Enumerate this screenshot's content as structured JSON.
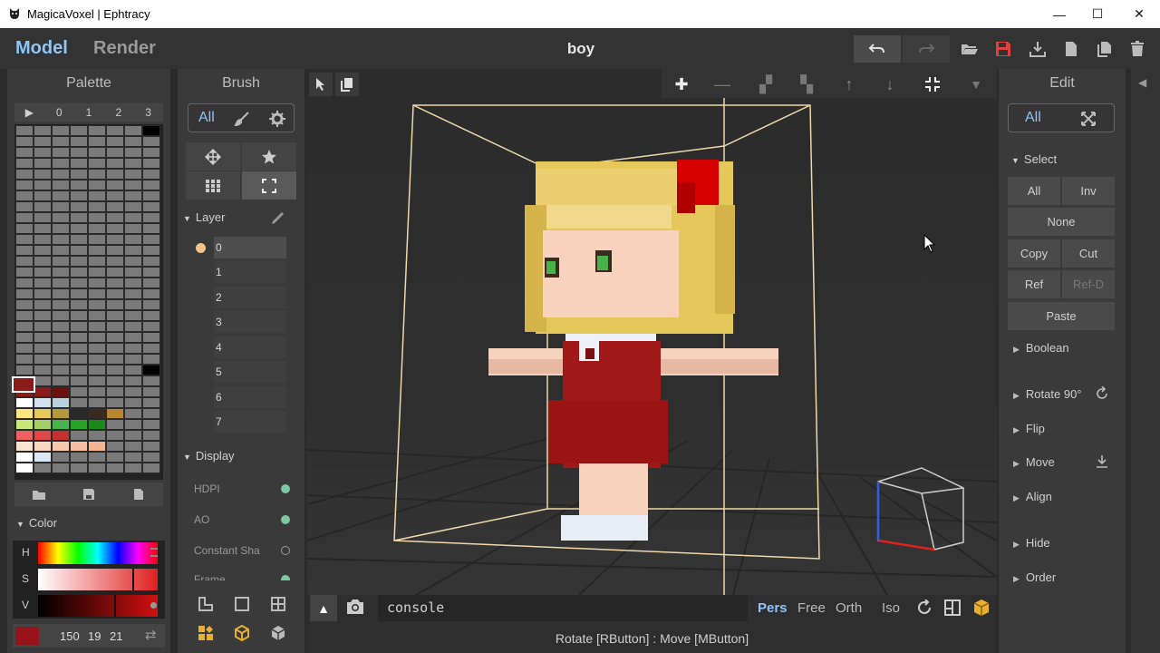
{
  "window": {
    "title": "MagicaVoxel | Ephtracy",
    "minimize": "—",
    "maximize": "☐",
    "close": "✕"
  },
  "topbar": {
    "mode_model": "Model",
    "mode_render": "Render",
    "doc_title": "boy"
  },
  "palette": {
    "title": "Palette",
    "tabs": [
      "▶",
      "0",
      "1",
      "2",
      "3"
    ],
    "swatches": [
      [
        "#7a7a7a",
        "#7a7a7a",
        "#7a7a7a",
        "#7a7a7a",
        "#7a7a7a",
        "#7a7a7a",
        "#7a7a7a",
        "#000000"
      ],
      [
        "#d50000",
        "#7a7a7a",
        "#7a7a7a",
        "#7a7a7a",
        "#7a7a7a",
        "#7a7a7a",
        "#7a7a7a",
        "#7a7a7a"
      ],
      [
        "#8b1a1a",
        "#8b1a1a",
        "#6d1010",
        "#7a7a7a",
        "#7a7a7a",
        "#7a7a7a",
        "#7a7a7a",
        "#7a7a7a"
      ],
      [
        "#ffffff",
        "#d0e2ef",
        "#b8d0de",
        "#7a7a7a",
        "#7a7a7a",
        "#7a7a7a",
        "#7a7a7a",
        "#7a7a7a"
      ],
      [
        "#ffe680",
        "#e6c85a",
        "#b59a3a",
        "#2a2a2a",
        "#3a2a20",
        "#b8862e",
        "#7a7a7a",
        "#7a7a7a"
      ],
      [
        "#c8e87a",
        "#a8d068",
        "#4ab24a",
        "#2aa32a",
        "#198a19",
        "#7a7a7a",
        "#7a7a7a",
        "#7a7a7a"
      ],
      [
        "#f06060",
        "#e04848",
        "#c83030",
        "#7a7a7a",
        "#7a7a7a",
        "#7a7a7a",
        "#7a7a7a",
        "#7a7a7a"
      ],
      [
        "#fde2d2",
        "#fcd6c0",
        "#f8c8ae",
        "#f6bea0",
        "#f3b491",
        "#7a7a7a",
        "#7a7a7a",
        "#7a7a7a"
      ],
      [
        "#ffffff",
        "#d8e8f5",
        "#7a7a7a",
        "#7a7a7a",
        "#7a7a7a",
        "#7a7a7a",
        "#7a7a7a",
        "#7a7a7a"
      ],
      [
        "#ffffff",
        "#7a7a7a",
        "#7a7a7a",
        "#7a7a7a",
        "#7a7a7a",
        "#7a7a7a",
        "#7a7a7a",
        "#7a7a7a"
      ]
    ]
  },
  "color": {
    "section": "Color",
    "h": "H",
    "s": "S",
    "v": "V",
    "r": "150",
    "g": "19",
    "b": "21",
    "current": "#96131"
  },
  "brush": {
    "title": "Brush",
    "all": "All",
    "layer_section": "Layer",
    "layers": [
      "0",
      "1",
      "2",
      "3",
      "4",
      "5",
      "6",
      "7"
    ],
    "display_section": "Display",
    "display_items": [
      {
        "label": "HDPI"
      },
      {
        "label": "AO"
      },
      {
        "label": "Constant Sha"
      },
      {
        "label": "Frame"
      }
    ]
  },
  "bottom": {
    "console": "console",
    "pers": "Pers",
    "free": "Free",
    "orth": "Orth",
    "iso": "Iso",
    "status": "Rotate [RButton] : Move [MButton]"
  },
  "edit": {
    "title": "Edit",
    "all": "All",
    "select_section": "Select",
    "btn_all": "All",
    "btn_inv": "Inv",
    "btn_none": "None",
    "btn_copy": "Copy",
    "btn_cut": "Cut",
    "btn_ref": "Ref",
    "btn_refd": "Ref-D",
    "btn_paste": "Paste",
    "boolean": "Boolean",
    "rotate": "Rotate 90°",
    "flip": "Flip",
    "move": "Move",
    "align": "Align",
    "hide": "Hide",
    "order": "Order"
  },
  "colors": {
    "accent_blue": "#8ec5f5",
    "red_save": "#e04040",
    "selected_color": "#96131"
  }
}
